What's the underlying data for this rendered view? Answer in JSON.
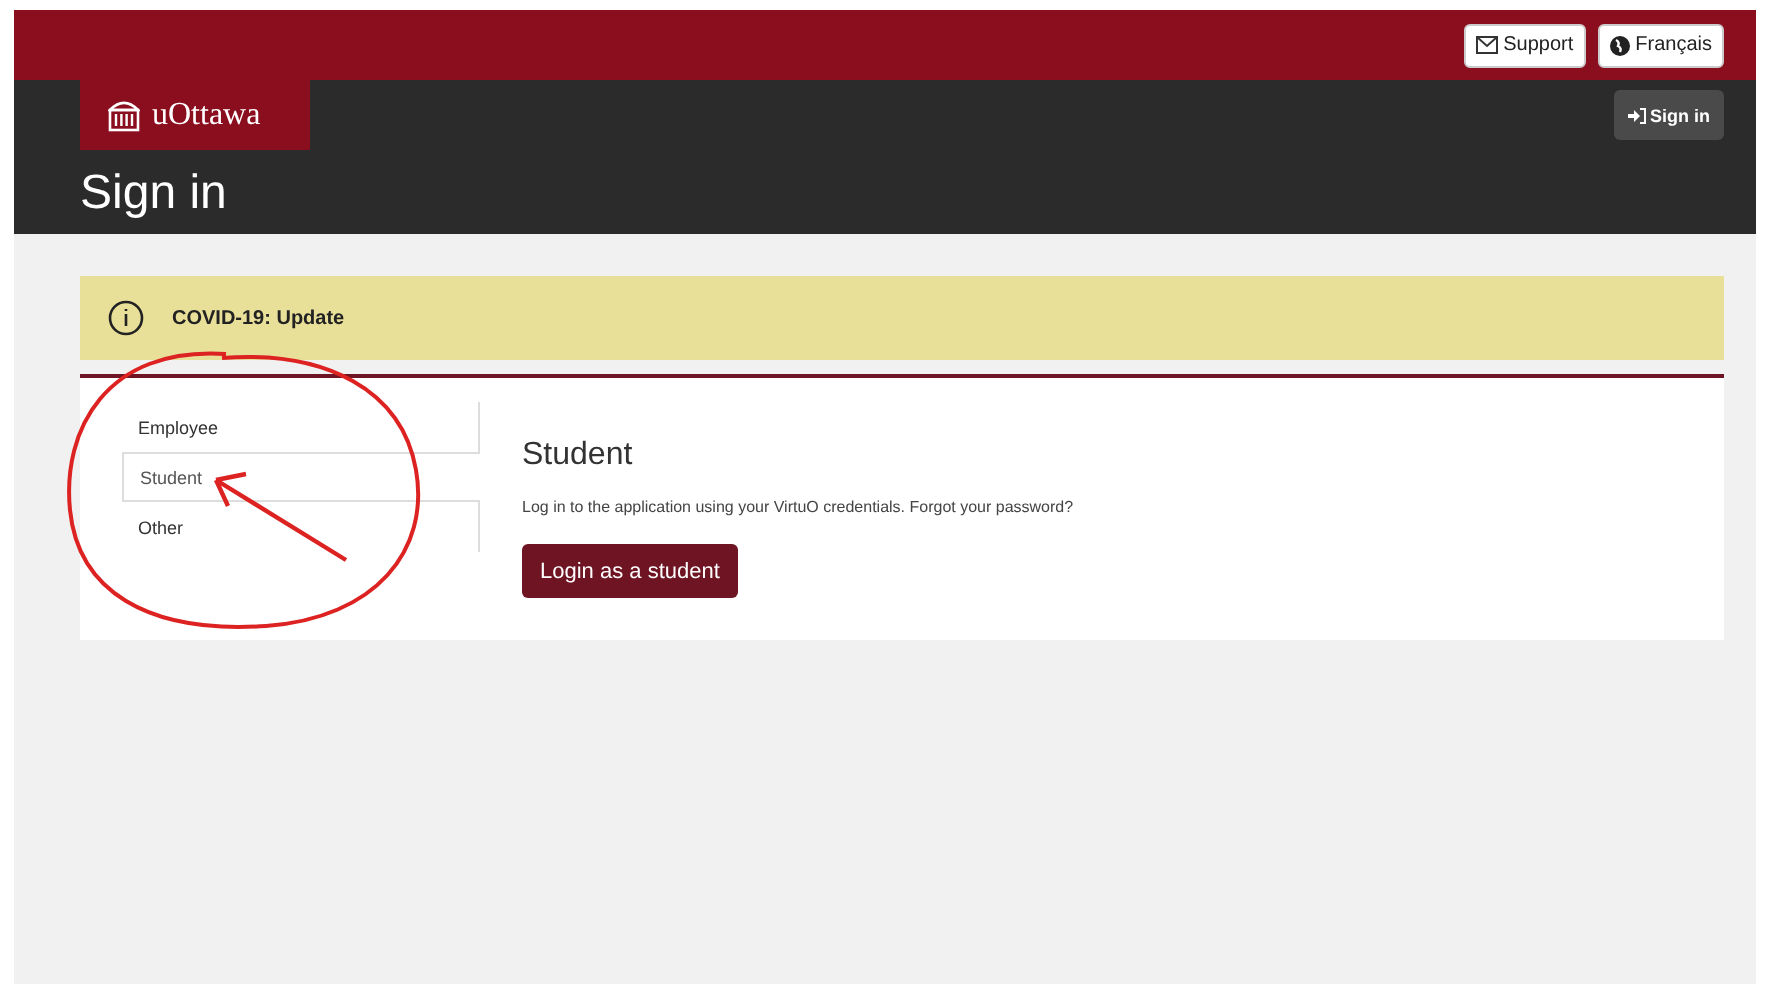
{
  "top_bar": {
    "buttons": [
      {
        "kind": "support",
        "label": "Support"
      },
      {
        "kind": "language",
        "label": "Français"
      }
    ]
  },
  "header": {
    "logo": "uOttawa",
    "title": "Sign in",
    "sign_in_button": "Sign in"
  },
  "notice": {
    "text": "COVID-19: Update"
  },
  "sign_in_tabs": [
    {
      "label": "Employee",
      "selected": false
    },
    {
      "label": "Student",
      "selected": true
    },
    {
      "label": "Other",
      "selected": false
    }
  ],
  "panel": {
    "heading": "Student",
    "description": "Log in to the application using your VirtuO credentials. Forgot your password?",
    "button": "Login as a student"
  }
}
